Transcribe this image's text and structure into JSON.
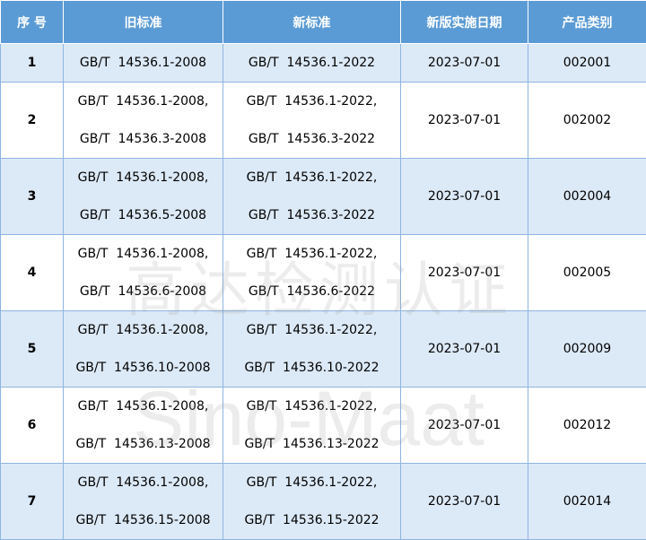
{
  "headers": [
    "序  号",
    "旧标准",
    "新标准",
    "新版实施日期",
    "产品类别"
  ],
  "rows": [
    {
      "no": "1",
      "old": [
        "GB/T  14536.1-2008"
      ],
      "new": [
        "GB/T  14536.1-2022"
      ],
      "date": "2023-07-01",
      "category": "002001"
    },
    {
      "no": "2",
      "old": [
        "GB/T  14536.1-2008,",
        "GB/T  14536.3-2008"
      ],
      "new": [
        "GB/T  14536.1-2022,",
        "GB/T  14536.3-2022"
      ],
      "date": "2023-07-01",
      "category": "002002"
    },
    {
      "no": "3",
      "old": [
        "GB/T  14536.1-2008,",
        "GB/T  14536.5-2008"
      ],
      "new": [
        "GB/T  14536.1-2022,",
        "GB/T  14536.3-2022"
      ],
      "date": "2023-07-01",
      "category": "002004"
    },
    {
      "no": "4",
      "old": [
        "GB/T  14536.1-2008,",
        "GB/T  14536.6-2008"
      ],
      "new": [
        "GB/T  14536.1-2022,",
        "GB/T  14536.6-2022"
      ],
      "date": "2023-07-01",
      "category": "002005"
    },
    {
      "no": "5",
      "old": [
        "GB/T  14536.1-2008,",
        "GB/T  14536.10-2008"
      ],
      "new": [
        "GB/T  14536.1-2022,",
        "GB/T  14536.10-2022"
      ],
      "date": "2023-07-01",
      "category": "002009"
    },
    {
      "no": "6",
      "old": [
        "GB/T  14536.1-2008,",
        "GB/T  14536.13-2008"
      ],
      "new": [
        "GB/T  14536.1-2022,",
        "GB/T  14536.13-2022"
      ],
      "date": "2023-07-01",
      "category": "002012"
    },
    {
      "no": "7",
      "old": [
        "GB/T  14536.1-2008,",
        "GB/T  14536.15-2008"
      ],
      "new": [
        "GB/T  14536.1-2022,",
        "GB/T  14536.15-2022"
      ],
      "date": "2023-07-01",
      "category": "002014"
    }
  ],
  "watermark": {
    "cn": "高达检测认证",
    "en": "Sino-Maat"
  },
  "colors": {
    "header_bg": "#5b9bd5",
    "shade_bg": "#dce9f6",
    "border": "#8eb4e3"
  }
}
